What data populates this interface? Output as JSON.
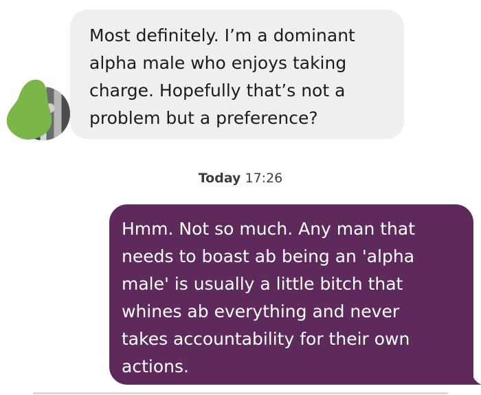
{
  "conversation": {
    "incoming_message": {
      "text": "Most definitely.   I’m a dominant\nalpha male who enjoys taking\ncharge. Hopefully that’s not a\nproblem but a preference?"
    },
    "timestamp": {
      "day": "Today",
      "time": "17:26"
    },
    "outgoing_message": {
      "text": "Hmm. Not so much. Any man that\nneeds to boast ab being an 'alpha\nmale' is usually a little bitch that\nwhines ab everything and never\ntakes accountability for their own\nactions."
    }
  },
  "colors": {
    "incoming_bubble": "#efeff1",
    "outgoing_bubble": "#5e2a5c",
    "avatar_scribble": "#7ab648"
  }
}
